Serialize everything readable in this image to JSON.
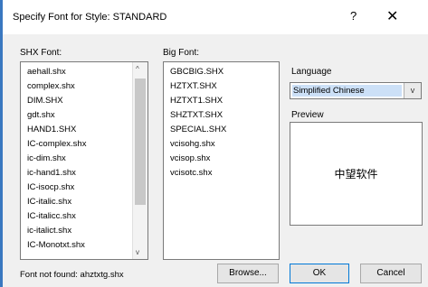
{
  "window": {
    "title": "Specify Font for Style: STANDARD",
    "help_glyph": "?",
    "close_glyph": "✕"
  },
  "shx_font": {
    "label": "SHX Font:",
    "items": [
      "aehall.shx",
      "complex.shx",
      "DIM.SHX",
      "gdt.shx",
      "HAND1.SHX",
      "IC-complex.shx",
      "ic-dim.shx",
      "ic-hand1.shx",
      "IC-isocp.shx",
      "IC-italic.shx",
      "IC-italicc.shx",
      "ic-italict.shx",
      "IC-Monotxt.shx"
    ],
    "scroll_up": "^",
    "scroll_down": "v"
  },
  "big_font": {
    "label": "Big Font:",
    "items": [
      "GBCBIG.SHX",
      "HZTXT.SHX",
      "HZTXT1.SHX",
      "SHZTXT.SHX",
      "SPECIAL.SHX",
      "vcisohg.shx",
      "vcisop.shx",
      "vcisotc.shx"
    ]
  },
  "language": {
    "label": "Language",
    "selected": "Simplified Chinese",
    "dropdown_glyph": "v"
  },
  "preview": {
    "label": "Preview",
    "sample_text": "中望软件"
  },
  "buttons": {
    "browse": "Browse...",
    "ok": "OK",
    "cancel": "Cancel"
  },
  "status": {
    "text": "Font not found: ahztxtg.shx"
  }
}
